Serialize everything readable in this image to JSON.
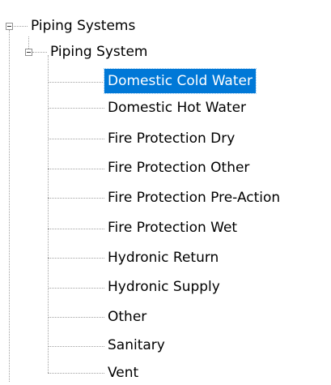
{
  "tree": {
    "root": {
      "label": "Piping Systems",
      "expanded": true,
      "children": [
        {
          "label": "Piping System",
          "expanded": true,
          "children": [
            {
              "label": "Domestic Cold Water",
              "selected": true
            },
            {
              "label": "Domestic Hot Water"
            },
            {
              "label": "Fire Protection Dry"
            },
            {
              "label": "Fire Protection Other"
            },
            {
              "label": "Fire Protection Pre-Action"
            },
            {
              "label": "Fire Protection Wet"
            },
            {
              "label": "Hydronic Return"
            },
            {
              "label": "Hydronic Supply"
            },
            {
              "label": "Other"
            },
            {
              "label": "Sanitary"
            },
            {
              "label": "Vent"
            }
          ]
        }
      ]
    },
    "colors": {
      "selection": "#0078d7",
      "selection_text": "#ffffff",
      "connector": "#a0a0a0"
    },
    "icons": {
      "expand_toggle": "collapse-minus-icon"
    }
  }
}
